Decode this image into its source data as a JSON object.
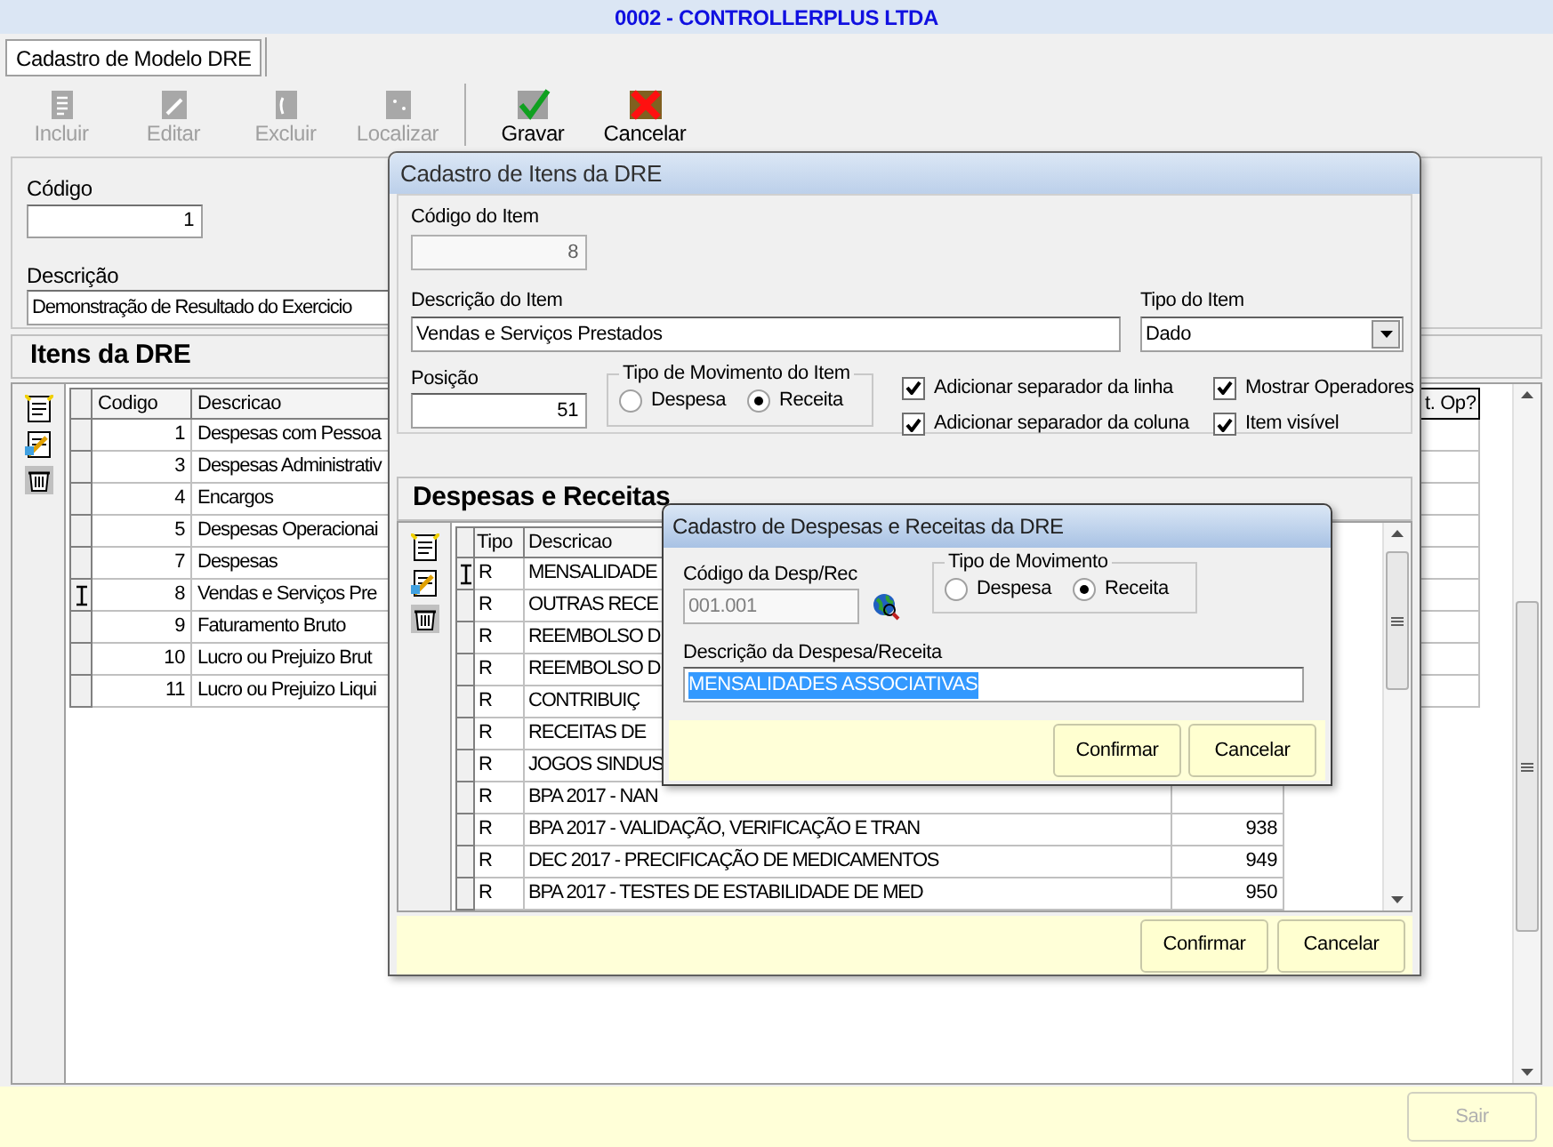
{
  "window": {
    "title": "0002 - CONTROLLERPLUS LTDA"
  },
  "tabs": [
    {
      "label": "Cadastro de Modelo DRE",
      "selected": true
    }
  ],
  "toolbar": [
    {
      "label": "Incluir",
      "disabled": true
    },
    {
      "label": "Editar",
      "disabled": true
    },
    {
      "label": "Excluir",
      "disabled": true
    },
    {
      "label": "Localizar",
      "disabled": true
    },
    {
      "label": "Gravar",
      "disabled": false
    },
    {
      "label": "Cancelar",
      "disabled": false
    }
  ],
  "form": {
    "codigo_label": "Código",
    "codigo": "1",
    "descricao_label": "Descrição",
    "descricao": "Demonstração de Resultado do Exercicio"
  },
  "items": {
    "title": "Itens da DRE",
    "columns": [
      "Codigo",
      "Descricao",
      "t. Op?"
    ],
    "rows": [
      {
        "codigo": "1",
        "descricao": "Despesas com Pessoa",
        "current": false
      },
      {
        "codigo": "3",
        "descricao": "Despesas Administrativ",
        "current": false
      },
      {
        "codigo": "4",
        "descricao": "Encargos",
        "current": false
      },
      {
        "codigo": "5",
        "descricao": "Despesas Operacionai",
        "current": false
      },
      {
        "codigo": "7",
        "descricao": "Despesas",
        "current": false
      },
      {
        "codigo": "8",
        "descricao": "Vendas e Serviços Pre",
        "current": true
      },
      {
        "codigo": "9",
        "descricao": "Faturamento Bruto",
        "current": false
      },
      {
        "codigo": "10",
        "descricao": "Lucro ou Prejuizo Brut",
        "current": false
      },
      {
        "codigo": "11",
        "descricao": "Lucro ou Prejuizo Liqui",
        "current": false
      }
    ]
  },
  "item_dialog": {
    "title": "Cadastro de Itens da DRE",
    "codigo_label": "Código do Item",
    "codigo": "8",
    "descricao_label": "Descrição do Item",
    "descricao": "Vendas e Serviços Prestados",
    "tipo_label": "Tipo do Item",
    "tipo": "Dado",
    "posicao_label": "Posição",
    "posicao": "51",
    "movimento": {
      "legend": "Tipo de Movimento do Item",
      "options": [
        {
          "label": "Despesa",
          "selected": false
        },
        {
          "label": "Receita",
          "selected": true
        }
      ]
    },
    "checks": [
      {
        "label": "Adicionar separador da linha",
        "checked": true
      },
      {
        "label": "Mostrar Operadores",
        "checked": true
      },
      {
        "label": "Adicionar separador da coluna",
        "checked": true
      },
      {
        "label": "Item visível",
        "checked": true
      }
    ],
    "section_title": "Despesas e Receitas",
    "columns": [
      "Tipo",
      "Descricao"
    ],
    "rows": [
      {
        "tipo": "R",
        "descricao": "MENSALIDADE",
        "current": true
      },
      {
        "tipo": "R",
        "descricao": "OUTRAS RECE",
        "current": false
      },
      {
        "tipo": "R",
        "descricao": "REEMBOLSO D",
        "current": false
      },
      {
        "tipo": "R",
        "descricao": "REEMBOLSO D",
        "current": false
      },
      {
        "tipo": "R",
        "descricao": "CONTRIBUIÇ",
        "current": false
      },
      {
        "tipo": "R",
        "descricao": "RECEITAS DE",
        "current": false
      },
      {
        "tipo": "R",
        "descricao": "JOGOS SINDUS",
        "current": false
      },
      {
        "tipo": "R",
        "descricao": "BPA 2017 - NAN",
        "current": false
      },
      {
        "tipo": "R",
        "descricao": "BPA 2017 - VALIDAÇÃO, VERIFICAÇÃO E TRAN",
        "valor": "938",
        "current": false
      },
      {
        "tipo": "R",
        "descricao": "DEC 2017 - PRECIFICAÇÃO DE MEDICAMENTOS",
        "valor": "949",
        "current": false
      },
      {
        "tipo": "R",
        "descricao": "BPA 2017 - TESTES DE ESTABILIDADE DE MED",
        "valor": "950",
        "current": false
      }
    ],
    "buttons": [
      "Confirmar",
      "Cancelar"
    ]
  },
  "desprec_dialog": {
    "title": "Cadastro de Despesas e Receitas da DRE",
    "codigo_label": "Código da Desp/Rec",
    "codigo": "001.001",
    "movimento": {
      "legend": "Tipo de Movimento",
      "options": [
        {
          "label": "Despesa",
          "selected": false
        },
        {
          "label": "Receita",
          "selected": true
        }
      ]
    },
    "descricao_label": "Descrição da Despesa/Receita",
    "descricao": "MENSALIDADES ASSOCIATIVAS",
    "buttons": [
      "Confirmar",
      "Cancelar"
    ]
  },
  "footer": {
    "button": {
      "label": "Sair",
      "disabled": true
    }
  }
}
